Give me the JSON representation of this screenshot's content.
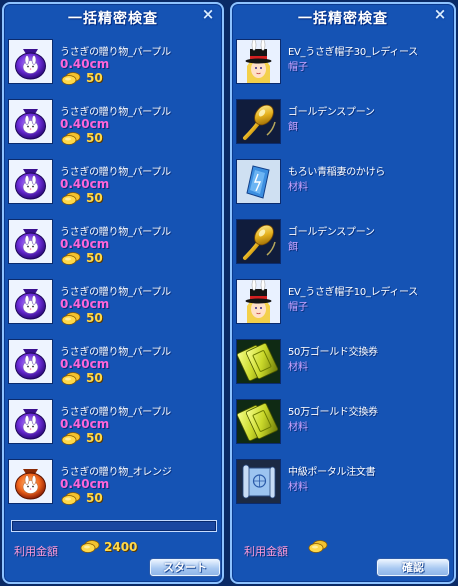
{
  "left_window": {
    "title": "一括精密検査",
    "close_glyph": "×",
    "items": [
      {
        "name": "うさぎの贈り物_パープル",
        "size": "0.40cm",
        "price": "50",
        "icon": "purple-rabbit-bag-icon"
      },
      {
        "name": "うさぎの贈り物_パープル",
        "size": "0.40cm",
        "price": "50",
        "icon": "purple-rabbit-bag-icon"
      },
      {
        "name": "うさぎの贈り物_パープル",
        "size": "0.40cm",
        "price": "50",
        "icon": "purple-rabbit-bag-icon"
      },
      {
        "name": "うさぎの贈り物_パープル",
        "size": "0.40cm",
        "price": "50",
        "icon": "purple-rabbit-bag-icon"
      },
      {
        "name": "うさぎの贈り物_パープル",
        "size": "0.40cm",
        "price": "50",
        "icon": "purple-rabbit-bag-icon"
      },
      {
        "name": "うさぎの贈り物_パープル",
        "size": "0.40cm",
        "price": "50",
        "icon": "purple-rabbit-bag-icon"
      },
      {
        "name": "うさぎの贈り物_パープル",
        "size": "0.40cm",
        "price": "50",
        "icon": "purple-rabbit-bag-icon"
      },
      {
        "name": "うさぎの贈り物_オレンジ",
        "size": "0.40cm",
        "price": "50",
        "icon": "orange-rabbit-bag-icon"
      }
    ],
    "progress": 0,
    "fee_label": "利用金額",
    "fee_value": "2400",
    "start_button": "スタート"
  },
  "right_window": {
    "title": "一括精密検査",
    "close_glyph": "×",
    "items": [
      {
        "name": "EV_うさぎ帽子30_レディース",
        "category": "帽子",
        "icon": "rabbit-hat-girl-icon"
      },
      {
        "name": "ゴールデンスプーン",
        "category": "餌",
        "icon": "golden-spoon-icon"
      },
      {
        "name": "もろい青稲妻のかけら",
        "category": "材料",
        "icon": "blue-lightning-shard-icon"
      },
      {
        "name": "ゴールデンスプーン",
        "category": "餌",
        "icon": "golden-spoon-icon"
      },
      {
        "name": "EV_うさぎ帽子10_レディース",
        "category": "帽子",
        "icon": "rabbit-hat-girl-icon"
      },
      {
        "name": "50万ゴールド交換券",
        "category": "材料",
        "icon": "gold-voucher-icon"
      },
      {
        "name": "50万ゴールド交換券",
        "category": "材料",
        "icon": "gold-voucher-icon"
      },
      {
        "name": "中級ポータル注文書",
        "category": "材料",
        "icon": "portal-scroll-icon"
      }
    ],
    "fee_label": "利用金額",
    "fee_value": "",
    "confirm_button": "確認"
  },
  "colors": {
    "panel_bg": "#1553b4",
    "panel_border": "#8ec3ff",
    "size_text": "#ff66d9",
    "category_text": "#c9a3ff",
    "price_text": "#ffd94a"
  }
}
